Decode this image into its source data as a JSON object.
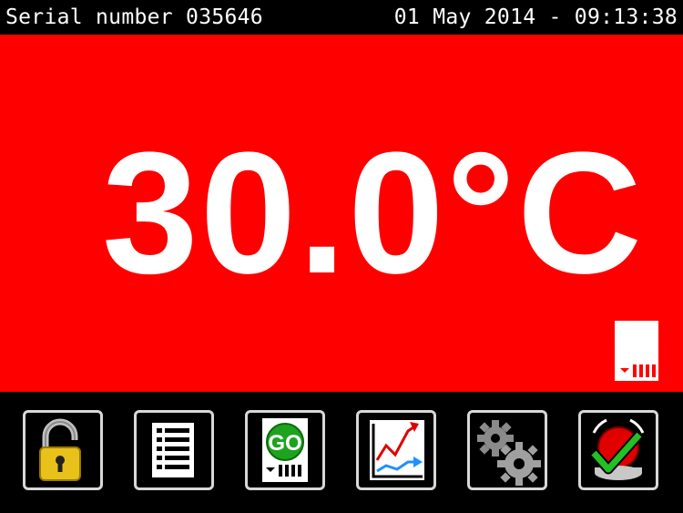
{
  "header": {
    "serial": "Serial number 035646",
    "datetime": "01 May 2014 - 09:13:38"
  },
  "display": {
    "temperature": "30.0°C",
    "background_color": "#ff0000",
    "status_icon": "sd-card-icon"
  },
  "toolbar": {
    "buttons": [
      {
        "icon": "unlock-icon"
      },
      {
        "icon": "list-icon"
      },
      {
        "icon": "go-record-icon",
        "label": "GO"
      },
      {
        "icon": "chart-icon"
      },
      {
        "icon": "gears-icon"
      },
      {
        "icon": "alarm-acknowledge-icon"
      }
    ]
  }
}
